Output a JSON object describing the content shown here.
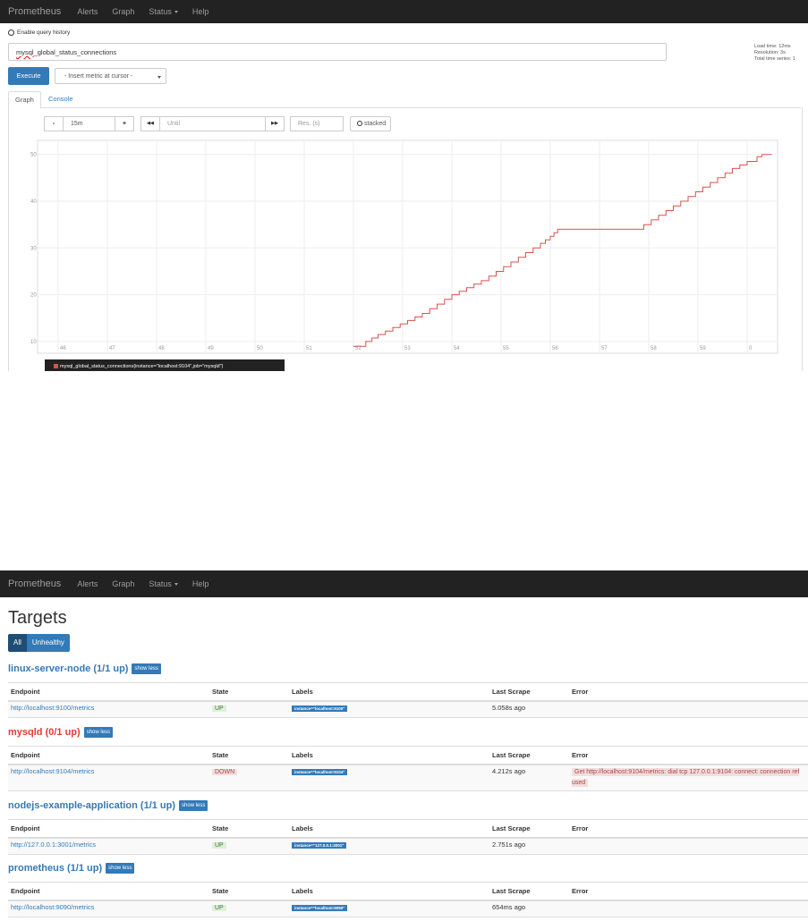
{
  "nav": {
    "brand": "Prometheus",
    "items": [
      "Alerts",
      "Graph",
      "Status",
      "Help"
    ]
  },
  "graph_page": {
    "enable_history": "Enable query history",
    "expression_prefix": "mysql",
    "expression_rest": "_global_status_connections",
    "stats": {
      "load_time": "Load time: 12ms",
      "resolution": "Resolution: 3s",
      "total_series": "Total time series: 1"
    },
    "execute": "Execute",
    "insert_metric": "- Insert metric at cursor -",
    "tabs": {
      "graph": "Graph",
      "console": "Console"
    },
    "controls": {
      "minus": "-",
      "range": "15m",
      "plus": "+",
      "back": "◀◀",
      "until": "Until",
      "forward": "▶▶",
      "res": "Res. (s)",
      "stacked": "stacked"
    },
    "legend": "mysql_global_status_connections{instance=\"localhost:9104\",job=\"mysqld\"}"
  },
  "chart_data": {
    "type": "line",
    "x_tick_labels": [
      "46",
      "47",
      "48",
      "49",
      "50",
      "51",
      "52",
      "53",
      "54",
      "55",
      "56",
      "57",
      "58",
      "59",
      "0"
    ],
    "y_tick_labels": [
      "10",
      "20",
      "30",
      "40",
      "50"
    ],
    "ylim": [
      7.5,
      53
    ],
    "grid": true,
    "series": [
      {
        "color": "#d9534f",
        "points": [
          [
            52.0,
            9
          ],
          [
            52.25,
            10
          ],
          [
            52.5,
            11.5
          ],
          [
            52.8,
            13
          ],
          [
            53.1,
            14.5
          ],
          [
            53.4,
            16
          ],
          [
            53.7,
            18
          ],
          [
            54.0,
            20
          ],
          [
            54.3,
            21.5
          ],
          [
            54.6,
            23
          ],
          [
            54.9,
            25
          ],
          [
            55.2,
            27
          ],
          [
            55.5,
            29
          ],
          [
            55.8,
            31
          ],
          [
            56.0,
            32.5
          ],
          [
            56.15,
            34
          ],
          [
            57.0,
            34
          ],
          [
            57.8,
            34
          ],
          [
            57.9,
            35
          ],
          [
            58.2,
            37
          ],
          [
            58.5,
            39
          ],
          [
            58.8,
            41
          ],
          [
            59.1,
            43
          ],
          [
            59.4,
            45
          ],
          [
            59.7,
            47
          ],
          [
            60.0,
            48.5
          ],
          [
            60.2,
            49.5
          ],
          [
            60.3,
            50
          ],
          [
            60.5,
            50
          ]
        ]
      }
    ]
  },
  "targets_page": {
    "title": "Targets",
    "filter": {
      "all": "All",
      "unhealthy": "Unhealthy"
    },
    "columns": [
      "Endpoint",
      "State",
      "Labels",
      "Last Scrape",
      "Error"
    ],
    "show_less": "show less",
    "jobs": [
      {
        "name": "linux-server-node (1/1 up)",
        "rows": [
          {
            "endpoint": "http://localhost:9100/metrics",
            "state": "UP",
            "label": "instance=\"localhost:9100\"",
            "last_scrape": "5.058s ago",
            "error": ""
          }
        ]
      },
      {
        "name": "mysqld (0/1 up)",
        "rows": [
          {
            "endpoint": "http://localhost:9104/metrics",
            "state": "DOWN",
            "label": "instance=\"localhost:9104\"",
            "last_scrape": "4.212s ago",
            "error": "Get http://localhost:9104/metrics: dial tcp 127.0.0.1:9104: connect: connection refused"
          }
        ]
      },
      {
        "name": "nodejs-example-application (1/1 up)",
        "rows": [
          {
            "endpoint": "http://127.0.0.1:3001/metrics",
            "state": "UP",
            "label": "instance=\"127.0.0.1:3001\"",
            "last_scrape": "2.751s ago",
            "error": ""
          }
        ]
      },
      {
        "name": "prometheus (1/1 up)",
        "rows": [
          {
            "endpoint": "http://localhost:9090/metrics",
            "state": "UP",
            "label": "instance=\"localhost:9090\"",
            "last_scrape": "654ms ago",
            "error": ""
          }
        ]
      }
    ]
  }
}
